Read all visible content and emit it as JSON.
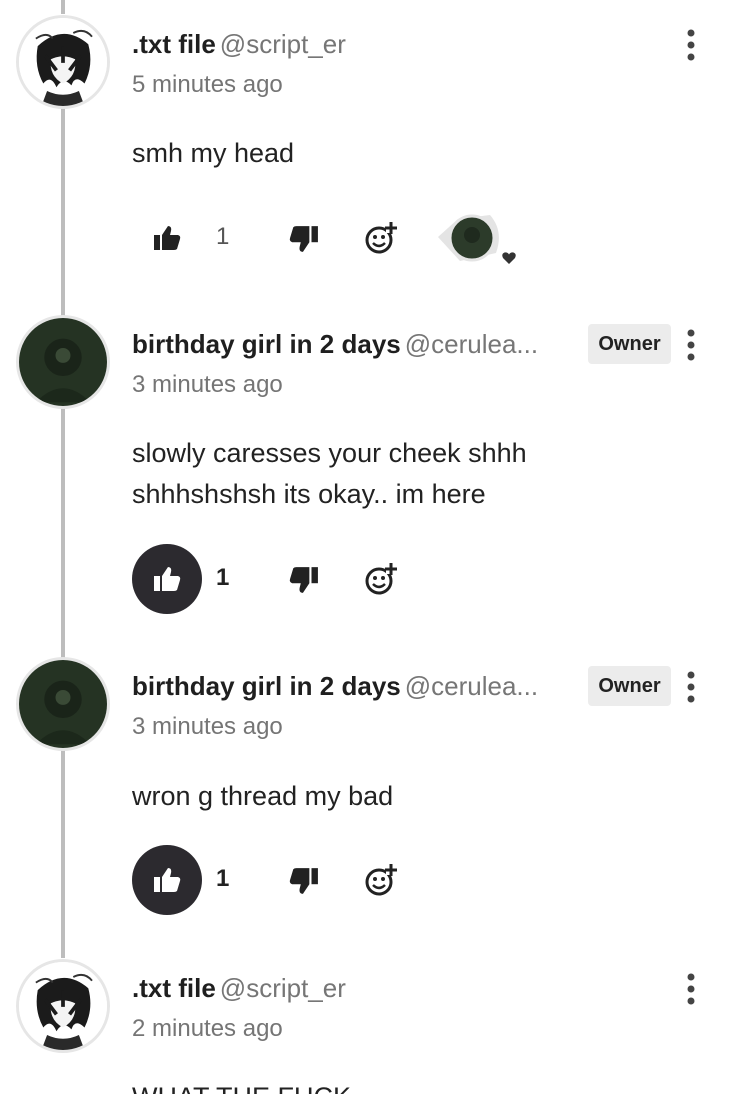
{
  "colors": {
    "thread_line": "#bdbdbd",
    "owner_badge_bg": "#ececec",
    "like_active_bg": "#2c2a2f",
    "text": "#222222",
    "muted_text": "#757575"
  },
  "comments": [
    {
      "author_name": ".txt file",
      "author_handle": "@script_er",
      "time": "5 minutes ago",
      "text": "smh my head",
      "badge": "",
      "like_count": "1",
      "liked": false,
      "creator_heart": true,
      "avatar_icon": "anime-avatar-icon"
    },
    {
      "author_name": "birthday girl in 2 days",
      "author_handle": "@cerulea...",
      "time": "3 minutes ago",
      "text": "slowly caresses your cheek shhh shhhshshsh its okay.. im here",
      "badge": "Owner",
      "like_count": "1",
      "liked": true,
      "creator_heart": false,
      "avatar_icon": "dark-green-avatar-icon"
    },
    {
      "author_name": "birthday girl in 2 days",
      "author_handle": "@cerulea...",
      "time": "3 minutes ago",
      "text": "wron g thread my bad",
      "badge": "Owner",
      "like_count": "1",
      "liked": true,
      "creator_heart": false,
      "avatar_icon": "dark-green-avatar-icon"
    },
    {
      "author_name": ".txt file",
      "author_handle": "@script_er",
      "time": "2 minutes ago",
      "text": "WHAT THE FUCK",
      "badge": "",
      "like_count": "",
      "liked": false,
      "creator_heart": false,
      "avatar_icon": "anime-avatar-icon"
    }
  ]
}
